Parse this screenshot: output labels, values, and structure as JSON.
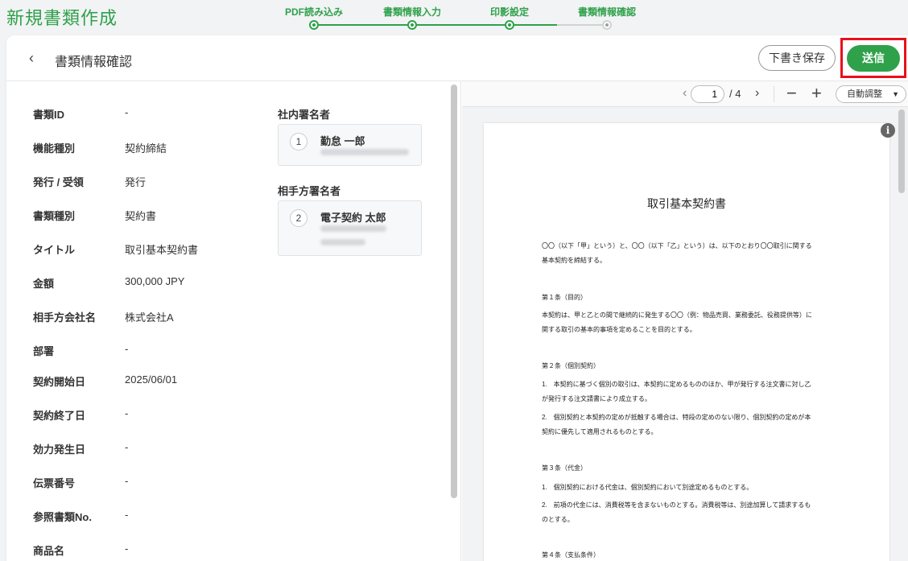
{
  "app": {
    "title": "新規書類作成"
  },
  "stepper": {
    "steps": [
      {
        "label": "PDF読み込み"
      },
      {
        "label": "書類情報入力"
      },
      {
        "label": "印影設定"
      },
      {
        "label": "書類情報確認"
      }
    ]
  },
  "header": {
    "title": "書類情報確認",
    "draft_label": "下書き保存",
    "send_label": "送信"
  },
  "fields": [
    {
      "label": "書類ID",
      "value": "-"
    },
    {
      "label": "機能種別",
      "value": "契約締結"
    },
    {
      "label": "発行 / 受領",
      "value": "発行"
    },
    {
      "label": "書類種別",
      "value": "契約書"
    },
    {
      "label": "タイトル",
      "value": "取引基本契約書"
    },
    {
      "label": "金額",
      "value": "300,000 JPY"
    },
    {
      "label": "相手方会社名",
      "value": "株式会社A"
    },
    {
      "label": "部署",
      "value": "-"
    },
    {
      "label": "契約開始日",
      "value": "2025/06/01"
    },
    {
      "label": "契約終了日",
      "value": "-"
    },
    {
      "label": "効力発生日",
      "value": "-"
    },
    {
      "label": "伝票番号",
      "value": "-"
    },
    {
      "label": "参照書類No.",
      "value": "-"
    },
    {
      "label": "商品名",
      "value": "-"
    }
  ],
  "signers": {
    "internal_title": "社内署名者",
    "internal": [
      {
        "num": "1",
        "name": "勤怠 一郎"
      }
    ],
    "counterparty_title": "相手方署名者",
    "counterparty": [
      {
        "num": "2",
        "name": "電子契約 太郎"
      }
    ]
  },
  "viewer": {
    "page_current": "1",
    "page_total": "/ 4",
    "zoom_label": "自動調整",
    "zoom_caret": "▼",
    "prev_icon": "‹",
    "next_icon": "›",
    "zoom_out_icon": "−",
    "zoom_in_icon": "+",
    "info_icon": "i"
  },
  "document": {
    "title": "取引基本契約書",
    "lines": [
      "〇〇（以下「甲」という）と、〇〇（以下「乙」という）は、以下のとおり〇〇取引に関する",
      "基本契約を締結する。",
      "第１条（目的）",
      "本契約は、甲と乙との間で継続的に発生する〇〇（例：物品売買、業務委託、役務提供等）に",
      "関する取引の基本的事項を定めることを目的とする。",
      "第２条（個別契約）",
      "1.　本契約に基づく個別の取引は、本契約に定めるもののほか、甲が発行する注文書に対し乙",
      "が発行する注文請書により成立する。",
      "2.　個別契約と本契約の定めが抵触する場合は、特段の定めのない限り、個別契約の定めが本",
      "契約に優先して適用されるものとする。",
      "第３条（代金）",
      "1.　個別契約における代金は、個別契約において別途定めるものとする。",
      "2.　前項の代金には、消費税等を含まないものとする。消費税等は、別途加算して請求するも",
      "のとする。",
      "第４条（支払条件）"
    ]
  },
  "colors": {
    "accent": "#2fa14a",
    "highlight": "#e8101a"
  }
}
